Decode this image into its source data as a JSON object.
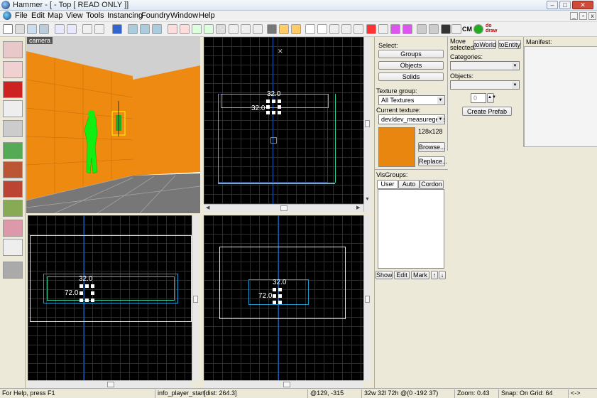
{
  "window": {
    "title": "Hammer - [ - Top [ READ ONLY ]]"
  },
  "menu": [
    "File",
    "Edit",
    "Map",
    "View",
    "Tools",
    "Instancing",
    "Foundry",
    "Window",
    "Help"
  ],
  "toolbar": {
    "cm_label": "CM",
    "draw_label": "do draw"
  },
  "viewports": {
    "camera_label": "camera",
    "top": {
      "width_label": "32.0",
      "height_label": "32.0"
    },
    "front": {
      "width_label": "32.0",
      "height_label": "72.0"
    },
    "side": {
      "width_label": "32.0",
      "height_label": "72.0"
    }
  },
  "select": {
    "label": "Select:",
    "groups": "Groups",
    "objects": "Objects",
    "solids": "Solids"
  },
  "texture": {
    "group_label": "Texture group:",
    "group_value": "All Textures",
    "current_label": "Current texture:",
    "current_value": "dev/dev_measuregene",
    "size": "128x128",
    "browse": "Browse...",
    "replace": "Replace...",
    "swatch_color": "#e8860f"
  },
  "visgroups": {
    "label": "VisGroups:",
    "tabs": [
      "User",
      "Auto",
      "Cordon"
    ],
    "show": "Show",
    "edit": "Edit",
    "mark": "Mark"
  },
  "move": {
    "label": "Move selected:",
    "to_world": "toWorld",
    "to_entity": "toEntity"
  },
  "prefab": {
    "categories_label": "Categories:",
    "objects_label": "Objects:",
    "count": "0",
    "create": "Create Prefab"
  },
  "manifest": {
    "label": "Manifest:"
  },
  "status": {
    "help": "For Help, press F1",
    "entity": "info_player_start",
    "dist": "[dist: 264.3]",
    "coords": "@129, -315",
    "size": "32w 32l 72h @(0 -192 37)",
    "zoom": "Zoom: 0.43",
    "snap": "Snap: On Grid: 64",
    "arrows": "<->"
  }
}
